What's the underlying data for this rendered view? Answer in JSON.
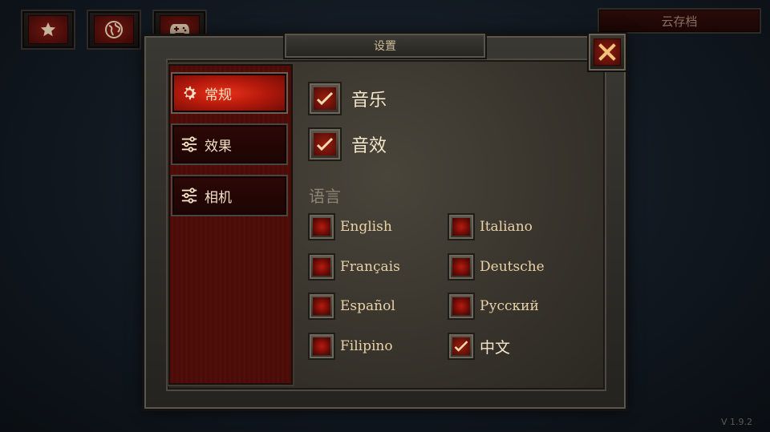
{
  "top_bar": {
    "buttons": [
      {
        "icon": "star-icon"
      },
      {
        "icon": "globe-icon"
      },
      {
        "icon": "gamepad-icon"
      }
    ],
    "cloud_save_label": "云存档"
  },
  "dialog": {
    "title": "设置",
    "close_icon": "close-icon",
    "tabs": [
      {
        "label": "常规",
        "icon": "gear-icon",
        "active": true
      },
      {
        "label": "效果",
        "icon": "sliders-icon",
        "active": false
      },
      {
        "label": "相机",
        "icon": "sliders-icon",
        "active": false
      }
    ],
    "toggles": [
      {
        "label": "音乐",
        "checked": true
      },
      {
        "label": "音效",
        "checked": true
      }
    ],
    "language_title": "语言",
    "languages": [
      {
        "label": "English",
        "checked": false
      },
      {
        "label": "Italiano",
        "checked": false
      },
      {
        "label": "Français",
        "checked": false
      },
      {
        "label": "Deutsche",
        "checked": false
      },
      {
        "label": "Español",
        "checked": false
      },
      {
        "label": "Русский",
        "checked": false
      },
      {
        "label": "Filipino",
        "checked": false
      },
      {
        "label": "中文",
        "checked": true
      }
    ]
  },
  "version": "V 1.9.2",
  "colors": {
    "accent_red": "#b71a0c",
    "checkmark": "#f3dcb0",
    "text": "#e9d2a8"
  }
}
